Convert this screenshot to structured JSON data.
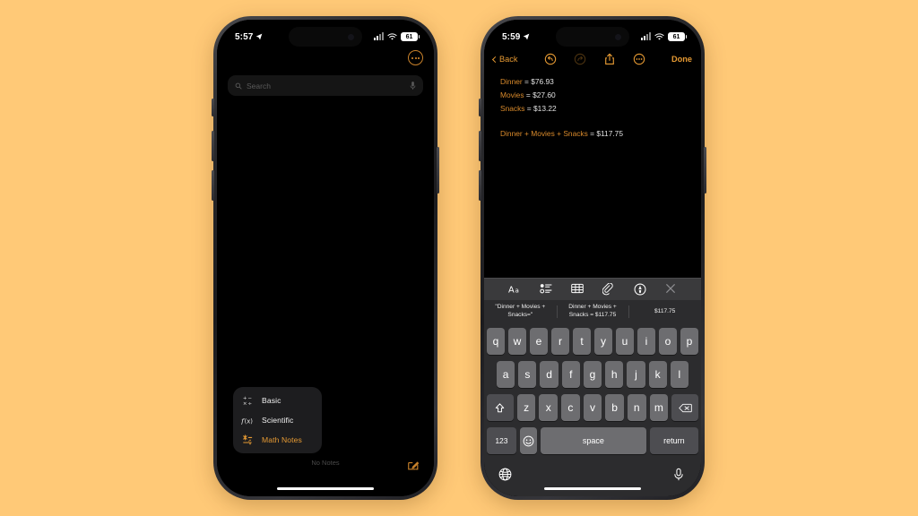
{
  "background_color": "#FFC977",
  "accent_color": "#E69A33",
  "left_phone": {
    "status_bar": {
      "time": "5:57",
      "battery": "61"
    },
    "app": "Notes",
    "search": {
      "placeholder": "Search"
    },
    "more_button_label": "More options",
    "empty_state": "No Notes",
    "compose_label": "New Note",
    "context_menu": {
      "items": [
        {
          "icon": "basic-calculator-icon",
          "label": "Basic",
          "active": false
        },
        {
          "icon": "scientific-calculator-icon",
          "label": "Scientific",
          "active": false
        },
        {
          "icon": "math-notes-icon",
          "label": "Math Notes",
          "active": true
        }
      ]
    }
  },
  "right_phone": {
    "status_bar": {
      "time": "5:59",
      "battery": "61"
    },
    "nav": {
      "back_label": "Back",
      "done_label": "Done",
      "undo_label": "Undo",
      "redo_label": "Redo",
      "share_label": "Share",
      "more_label": "More"
    },
    "note": {
      "lines": [
        {
          "name": "Dinner",
          "operators": [],
          "result": "= $76.93"
        },
        {
          "name": "Movies",
          "operators": [],
          "result": "= $27.60"
        },
        {
          "name": "Snacks",
          "operators": [],
          "result": "= $13.22"
        }
      ],
      "expression": {
        "terms": [
          "Dinner",
          "Movies",
          "Snacks"
        ],
        "operator": "+",
        "result": "= $117.75"
      },
      "line1_name": "Dinner",
      "line1_result": "= $76.93",
      "line2_name": "Movies",
      "line2_result": "= $27.60",
      "line3_name": "Snacks",
      "line3_result": "= $13.22",
      "sum_result": "= $117.75"
    },
    "format_toolbar": {
      "items": [
        {
          "icon": "text-format-icon",
          "label": "Aa"
        },
        {
          "icon": "checklist-icon",
          "label": "Checklist"
        },
        {
          "icon": "table-icon",
          "label": "Table"
        },
        {
          "icon": "attachment-icon",
          "label": "Attach"
        },
        {
          "icon": "markup-icon",
          "label": "Markup"
        },
        {
          "icon": "close-icon",
          "label": "Close"
        }
      ]
    },
    "suggestions": [
      "\"Dinner + Movies + Snacks=\"",
      "Dinner + Movies + Snacks = $117.75",
      "$117.75"
    ],
    "keyboard": {
      "row1": [
        "q",
        "w",
        "e",
        "r",
        "t",
        "y",
        "u",
        "i",
        "o",
        "p"
      ],
      "row2": [
        "a",
        "s",
        "d",
        "f",
        "g",
        "h",
        "j",
        "k",
        "l"
      ],
      "row3": [
        "z",
        "x",
        "c",
        "v",
        "b",
        "n",
        "m"
      ],
      "shift_label": "shift",
      "delete_label": "delete",
      "numbers_label": "123",
      "emoji_label": "emoji",
      "space_label": "space",
      "return_label": "return",
      "globe_label": "globe",
      "dictation_label": "dictation"
    }
  }
}
